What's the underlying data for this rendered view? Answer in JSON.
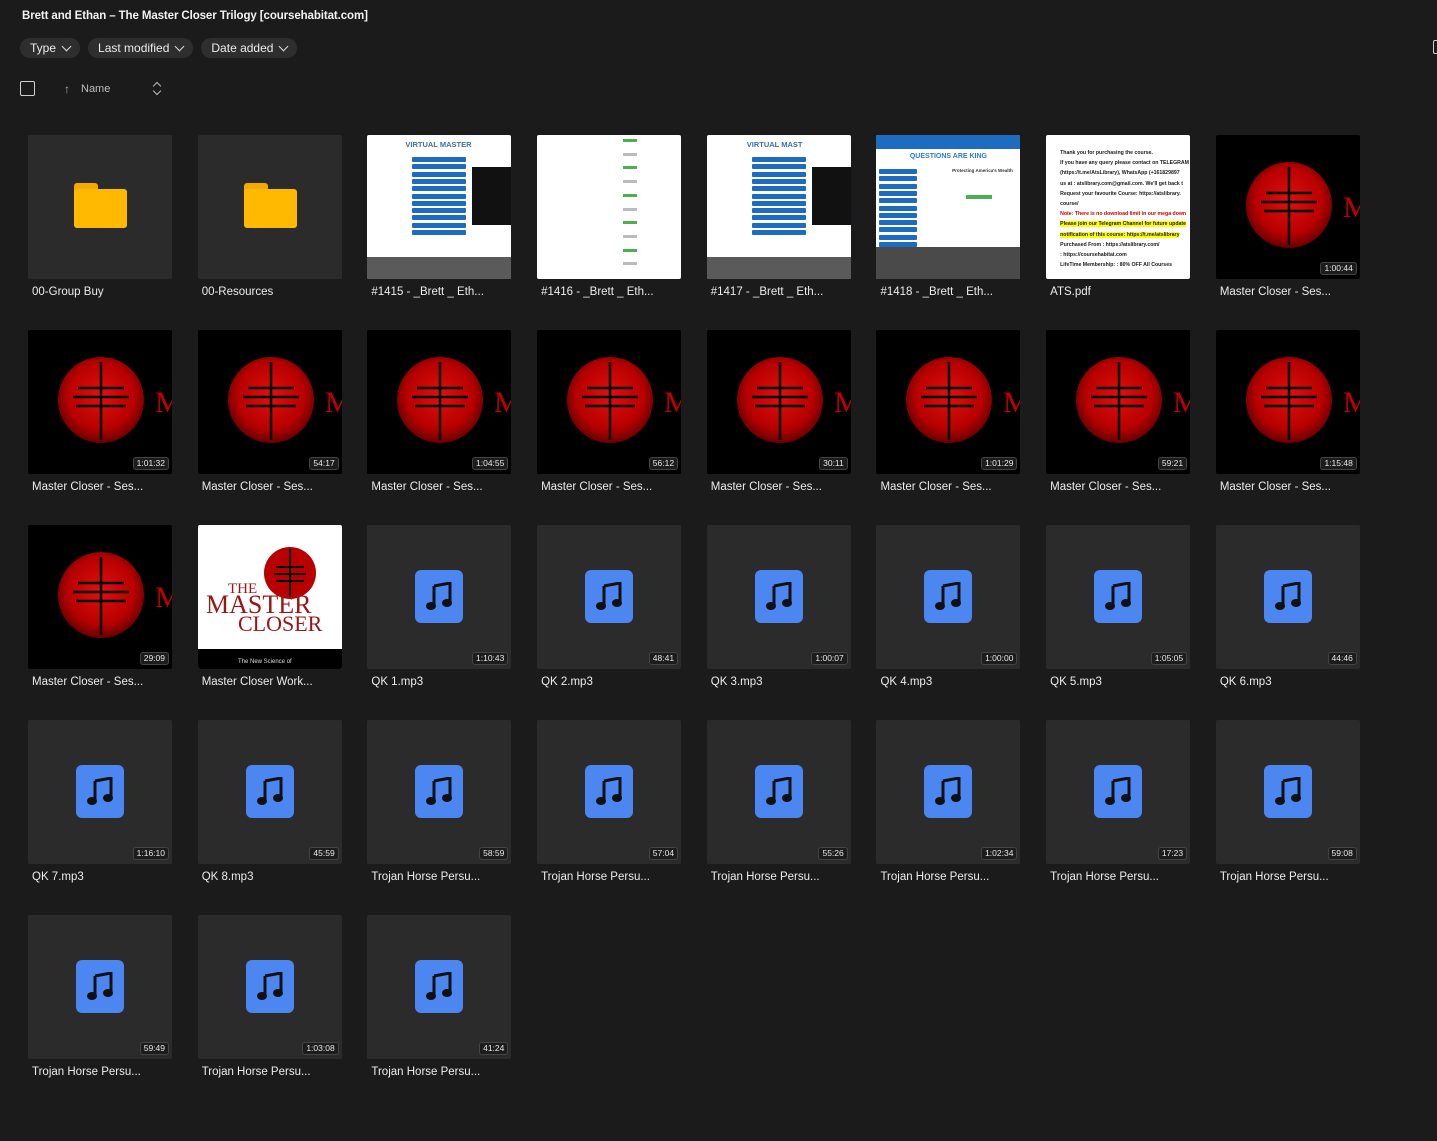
{
  "header": {
    "title": "Brett and Ethan – The Master Closer Trilogy [coursehabitat.com]"
  },
  "filters": [
    {
      "label": "Type"
    },
    {
      "label": "Last modified"
    },
    {
      "label": "Date added"
    }
  ],
  "sort": {
    "label": "Name"
  },
  "colors": {
    "folder": "#ffb900",
    "audio": "#4c86f0",
    "logo_red": "#c00000",
    "background": "#1b1b1b"
  },
  "files": [
    {
      "name": "00-Group Buy",
      "kind": "folder"
    },
    {
      "name": "00-Resources",
      "kind": "folder"
    },
    {
      "name": "#1415 - _Brett _ Eth...",
      "kind": "screenshot",
      "variant": "virtual"
    },
    {
      "name": "#1416 - _Brett _ Eth...",
      "kind": "screenshot",
      "variant": "list"
    },
    {
      "name": "#1417 - _Brett _ Eth...",
      "kind": "screenshot",
      "variant": "virtual2"
    },
    {
      "name": "#1418 - _Brett _ Eth...",
      "kind": "screenshot",
      "variant": "questions"
    },
    {
      "name": "ATS.pdf",
      "kind": "pdf"
    },
    {
      "name": "Master Closer - Ses...",
      "kind": "video",
      "duration": "1:00:44"
    },
    {
      "name": "Master Closer - Ses...",
      "kind": "video",
      "duration": "1:01:32"
    },
    {
      "name": "Master Closer - Ses...",
      "kind": "video",
      "duration": "54:17"
    },
    {
      "name": "Master Closer - Ses...",
      "kind": "video",
      "duration": "1:04:55"
    },
    {
      "name": "Master Closer - Ses...",
      "kind": "video",
      "duration": "56:12"
    },
    {
      "name": "Master Closer - Ses...",
      "kind": "video",
      "duration": "30:11"
    },
    {
      "name": "Master Closer - Ses...",
      "kind": "video",
      "duration": "1:01:29"
    },
    {
      "name": "Master Closer - Ses...",
      "kind": "video",
      "duration": "59:21"
    },
    {
      "name": "Master Closer - Ses...",
      "kind": "video",
      "duration": "1:15:48"
    },
    {
      "name": "Master Closer - Ses...",
      "kind": "video",
      "duration": "29:09"
    },
    {
      "name": "Master Closer Work...",
      "kind": "cover",
      "cover_title": [
        "THE",
        "MASTER",
        "CLOSER"
      ],
      "cover_sub": "The New Science of"
    },
    {
      "name": "QK 1.mp3",
      "kind": "audio",
      "duration": "1:10:43"
    },
    {
      "name": "QK 2.mp3",
      "kind": "audio",
      "duration": "48:41"
    },
    {
      "name": "QK 3.mp3",
      "kind": "audio",
      "duration": "1:00:07"
    },
    {
      "name": "QK 4.mp3",
      "kind": "audio",
      "duration": "1:00:00"
    },
    {
      "name": "QK 5.mp3",
      "kind": "audio",
      "duration": "1:05:05"
    },
    {
      "name": "QK 6.mp3",
      "kind": "audio",
      "duration": "44:46"
    },
    {
      "name": "QK 7.mp3",
      "kind": "audio",
      "duration": "1:16:10"
    },
    {
      "name": "QK 8.mp3",
      "kind": "audio",
      "duration": "45:59"
    },
    {
      "name": "Trojan Horse Persu...",
      "kind": "audio",
      "duration": "58:59"
    },
    {
      "name": "Trojan Horse Persu...",
      "kind": "audio",
      "duration": "57:04"
    },
    {
      "name": "Trojan Horse Persu...",
      "kind": "audio",
      "duration": "55:26"
    },
    {
      "name": "Trojan Horse Persu...",
      "kind": "audio",
      "duration": "1:02:34"
    },
    {
      "name": "Trojan Horse Persu...",
      "kind": "audio",
      "duration": "17:23"
    },
    {
      "name": "Trojan Horse Persu...",
      "kind": "audio",
      "duration": "59:08"
    },
    {
      "name": "Trojan Horse Persu...",
      "kind": "audio",
      "duration": "59:49"
    },
    {
      "name": "Trojan Horse Persu...",
      "kind": "audio",
      "duration": "1:03:08"
    },
    {
      "name": "Trojan Horse Persu...",
      "kind": "audio",
      "duration": "41:24"
    }
  ],
  "thumb_text": {
    "virtual": "VIRTUAL MASTER",
    "virtual2": "VIRTUAL MAST",
    "questions": "QUESTIONS ARE KING",
    "questions_sub": "Protecting America's Wealth",
    "pdf_lines": [
      "Thank you for purchasing the course.",
      "If you have any query please contact on TELEGRAM",
      "(https://t.me/AtsLibrary), WhatsApp (+161829897",
      "us at : atslibrary.com@gmail.com. We'll get back t",
      "Request your favourite Course: https://atslibrary.",
      "course/",
      "Note: There is no download limit in our mega down",
      "Please join our Telegram Channel for future update",
      "notification of this course: https://t.me/atslibrary",
      "Purchased From : https://atslibrary.com/",
      ": https://coursehabitat.com",
      "LifeTime Membership: : 80% OFF All Courses"
    ]
  }
}
